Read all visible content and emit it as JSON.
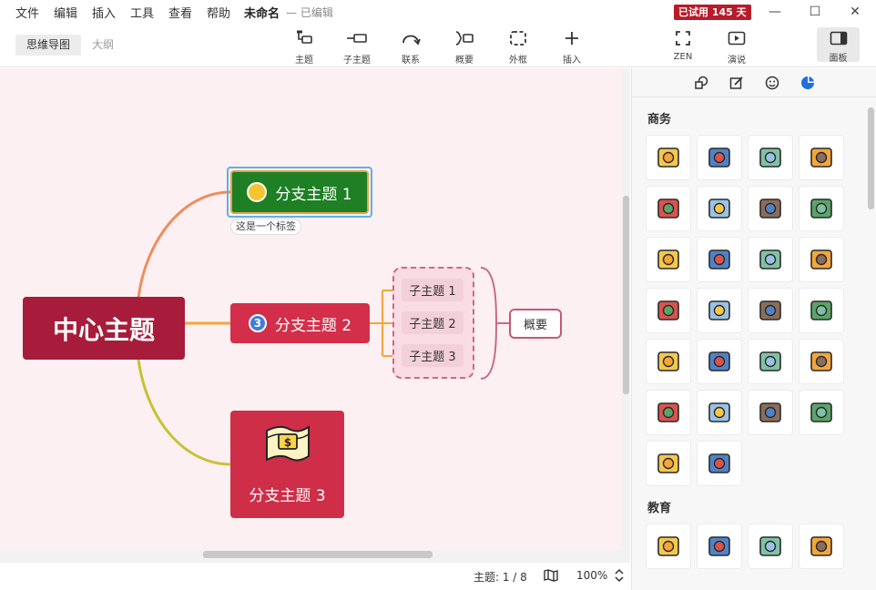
{
  "menu": [
    "文件",
    "编辑",
    "插入",
    "工具",
    "查看",
    "帮助"
  ],
  "document": {
    "title": "未命名",
    "status": "— 已编辑"
  },
  "trial_badge": "已试用 145 天",
  "view_tabs": [
    "思维导图",
    "大纲"
  ],
  "toolbar": {
    "topic": "主题",
    "subtopic": "子主题",
    "relationship": "联系",
    "summary": "概要",
    "boundary": "外框",
    "insert": "插入",
    "zen": "ZEN",
    "present": "演说",
    "panel": "面板"
  },
  "map": {
    "central": "中心主题",
    "branch1": "分支主题 1",
    "branch1_label": "这是一个标签",
    "branch2": "分支主题 2",
    "branch2_badge": "3",
    "branch3": "分支主题 3",
    "subtopics": [
      "子主题 1",
      "子主题 2",
      "子主题 3"
    ],
    "summary": "概要"
  },
  "status": {
    "topic_count": "主题: 1 / 8",
    "zoom": "100%"
  },
  "panel": {
    "sections": [
      "商务",
      "教育"
    ],
    "business_stickers": [
      "money-icon",
      "briefcase-icon",
      "calculator-icon",
      "chat-bubble-icon",
      "coffee-icon",
      "contacts-icon",
      "support-agent-icon",
      "mail-icon",
      "document-search-icon",
      "folder-icon",
      "globe-icon",
      "mailbox-icon",
      "turntable-icon",
      "newspaper-icon",
      "book-icon",
      "presentation-icon",
      "printer-icon",
      "analytics-icon",
      "target-icon",
      "team-icon",
      "clock-icon",
      "checklist-icon",
      "bar-chart-icon",
      "coins-icon",
      "microphone-icon",
      "id-card-icon"
    ],
    "education_stickers": [
      "atom-icon",
      "scales-icon",
      "chemistry-icon",
      "newtons-cradle-icon"
    ]
  },
  "colors": {
    "central": "#a81c3b",
    "branch1": "#1e7f25",
    "branch2": "#d32f4a",
    "branch3": "#cf2e48",
    "canvas": "#fcf0f2",
    "trial": "#b71c2b"
  }
}
